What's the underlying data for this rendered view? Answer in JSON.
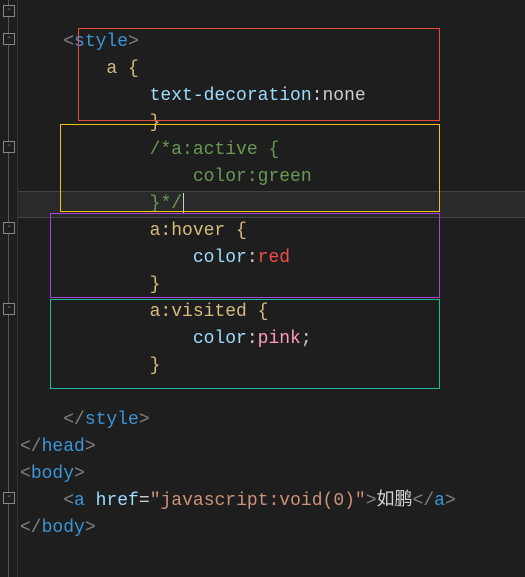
{
  "code": {
    "style_open_tag": "style",
    "rule_a": {
      "selector": "a",
      "prop": "text-decoration",
      "value": "none"
    },
    "rule_active_comment": {
      "open": "/*",
      "selector": "a:active",
      "prop": "color",
      "value": "green",
      "close": "*/"
    },
    "rule_hover": {
      "selector": "a:hover",
      "prop": "color",
      "value": "red"
    },
    "rule_visited": {
      "selector": "a:visited",
      "prop": "color",
      "value": "pink"
    },
    "style_close_tag": "style",
    "head_close": "head",
    "body_open": "body",
    "link": {
      "tag": "a",
      "attr": "href",
      "value": "\"javascript:void(0)\"",
      "text": "如鹏"
    },
    "body_close": "body"
  },
  "glyphs": {
    "open_brace": " {",
    "close_brace": "}",
    "lt": "<",
    "gt": ">",
    "lts": "</",
    "eq": "=",
    "colon": ":",
    "semi": ";",
    "minus": "-"
  }
}
